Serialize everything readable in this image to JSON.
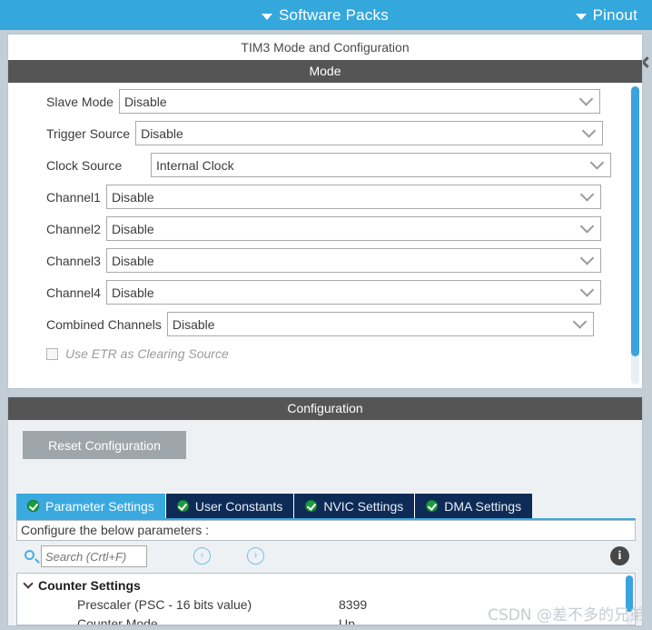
{
  "topbar": {
    "software_packs": "Software Packs",
    "pinout": "Pinout",
    "chevron_icon": "chevron-down-icon"
  },
  "mode_panel": {
    "title": "TIM3 Mode and Configuration",
    "section_band": "Mode",
    "fields": [
      {
        "label": "Slave Mode",
        "value": "Disable"
      },
      {
        "label": "Trigger Source",
        "value": "Disable"
      },
      {
        "label": "Clock Source",
        "value": "Internal Clock"
      },
      {
        "label": "Channel1",
        "value": "Disable"
      },
      {
        "label": "Channel2",
        "value": "Disable"
      },
      {
        "label": "Channel3",
        "value": "Disable"
      },
      {
        "label": "Channel4",
        "value": "Disable"
      },
      {
        "label": "Combined Channels",
        "value": "Disable"
      }
    ],
    "checkbox": {
      "label": "Use ETR as Clearing Source",
      "checked": false,
      "enabled": false
    }
  },
  "config_panel": {
    "band": "Configuration",
    "reset_button": "Reset Configuration",
    "tabs": [
      {
        "label": "Parameter Settings",
        "active": true,
        "status_icon": "check-circle-icon"
      },
      {
        "label": "User Constants",
        "active": false,
        "status_icon": "check-circle-icon"
      },
      {
        "label": "NVIC Settings",
        "active": false,
        "status_icon": "check-circle-icon"
      },
      {
        "label": "DMA Settings",
        "active": false,
        "status_icon": "check-circle-icon"
      }
    ],
    "hint": "Configure the below parameters :",
    "search": {
      "placeholder": "Search (Crtl+F)",
      "value": "",
      "icon": "search-icon",
      "prev_label": "‹",
      "next_label": "›",
      "info_label": "i"
    },
    "tree": {
      "group": "Counter Settings",
      "rows": [
        {
          "name": "Prescaler (PSC - 16 bits value)",
          "value": "8399"
        },
        {
          "name": "Counter Mode",
          "value": "Up"
        }
      ]
    }
  },
  "watermark": "CSDN @差不多的兄弟",
  "colors": {
    "accent_blue": "#34a8dd",
    "band_gray": "#555555",
    "tab_navy": "#0d2b56",
    "tab_active": "#3aa9e0",
    "check_green": "#1f9b3f"
  }
}
